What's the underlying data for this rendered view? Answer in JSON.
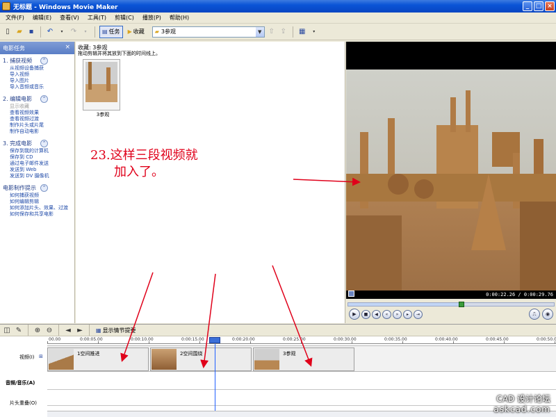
{
  "window": {
    "title": "无标题 - Windows Movie Maker",
    "buttons": [
      "_",
      "□",
      "×"
    ]
  },
  "menu": [
    "文件(F)",
    "编辑(E)",
    "查看(V)",
    "工具(T)",
    "剪辑(C)",
    "播放(P)",
    "帮助(H)"
  ],
  "toolbar": {
    "tasks_label": "任务",
    "collections_label": "收藏",
    "collection_value": "3参观"
  },
  "tasks_pane": {
    "title": "电影任务",
    "sections": [
      {
        "title": "1. 捕获视频",
        "items": [
          {
            "label": "从视频设备捕获"
          },
          {
            "label": "导入视频"
          },
          {
            "label": "导入图片"
          },
          {
            "label": "导入音频或音乐"
          }
        ]
      },
      {
        "title": "2. 编辑电影",
        "items": [
          {
            "label": "显示收藏",
            "disabled": true
          },
          {
            "label": "查看视频效果"
          },
          {
            "label": "查看视频过渡"
          },
          {
            "label": "制作片头或片尾"
          },
          {
            "label": "制作自动电影"
          }
        ]
      },
      {
        "title": "3. 完成电影",
        "items": [
          {
            "label": "保存到我的计算机"
          },
          {
            "label": "保存到 CD"
          },
          {
            "label": "通过电子邮件发送"
          },
          {
            "label": "发送到 Web"
          },
          {
            "label": "发送到 DV 摄像机"
          }
        ]
      },
      {
        "title": "电影制作提示",
        "items": [
          {
            "label": "如何捕获视频"
          },
          {
            "label": "如何编辑剪辑"
          },
          {
            "label": "如何添加片头、效果、过渡"
          },
          {
            "label": "如何保存和共享电影"
          }
        ]
      }
    ]
  },
  "collection": {
    "header": "收藏: 3参观",
    "hint": "拖动剪辑并将其放到下面的时间线上。",
    "clips": [
      {
        "name": "3参观"
      }
    ]
  },
  "annotation": {
    "line1": "23.这样三段视频就",
    "line2": "加入了。"
  },
  "monitor": {
    "time": "0:00:22.26 / 0:00:29.76",
    "progress": 0.55
  },
  "timeline": {
    "storyboard_label": "显示情节提要",
    "ruler": [
      "00.00",
      "0:00:05.00",
      "0:00:10.00",
      "0:00:15.00",
      "0:00:20.00",
      "0:00:25.00",
      "0:00:30.00",
      "0:00:35.00",
      "0:00:40.00",
      "0:00:45.00",
      "0:00:50.00"
    ],
    "tracks": {
      "video": "视频(I)",
      "audio": "音频/音乐(A)",
      "overlay": "片头重叠(O)"
    },
    "clips": [
      {
        "name": "1空间推进"
      },
      {
        "name": "2空间围绕"
      },
      {
        "name": "3参观"
      }
    ]
  },
  "watermark": {
    "line1": "CAD 设计论坛",
    "line2": "askcad.com"
  },
  "colors": {
    "titlebar": "#0a54d6",
    "annotation": "#e0001a",
    "link": "#1f4aa8",
    "playhead": "#1f5fff"
  }
}
